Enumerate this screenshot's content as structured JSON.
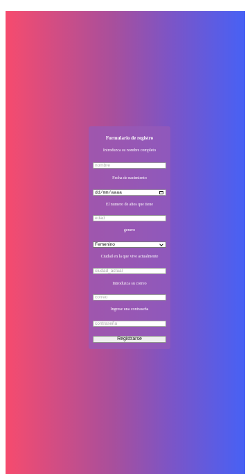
{
  "form": {
    "title": "Formulario de registro",
    "name_label": "Introduzca su nombre completo",
    "name_placeholder": "nombre",
    "birth_label": "Fecha de nacimiento",
    "birth_placeholder": "dd/mm/aaaa",
    "age_label": "El numero de años que tiene",
    "age_placeholder": "edad",
    "gender_label": "genero",
    "gender_value": "Femenino",
    "city_label": "Ciudad en la que vive actualmente",
    "city_placeholder": "ciudad_actual",
    "email_label": "Introduzca su correo",
    "email_placeholder": "correo",
    "password_label": "Ingrese una contraseña",
    "password_placeholder": "contraseña",
    "submit_label": "Registrarse"
  },
  "colors": {
    "gradient_left": "#f64b6e",
    "gradient_right": "#4761f5",
    "card_background": "#965ab9"
  },
  "icons": {
    "date_picker": "calendar-icon",
    "select_arrow": "chevron-down-icon"
  }
}
